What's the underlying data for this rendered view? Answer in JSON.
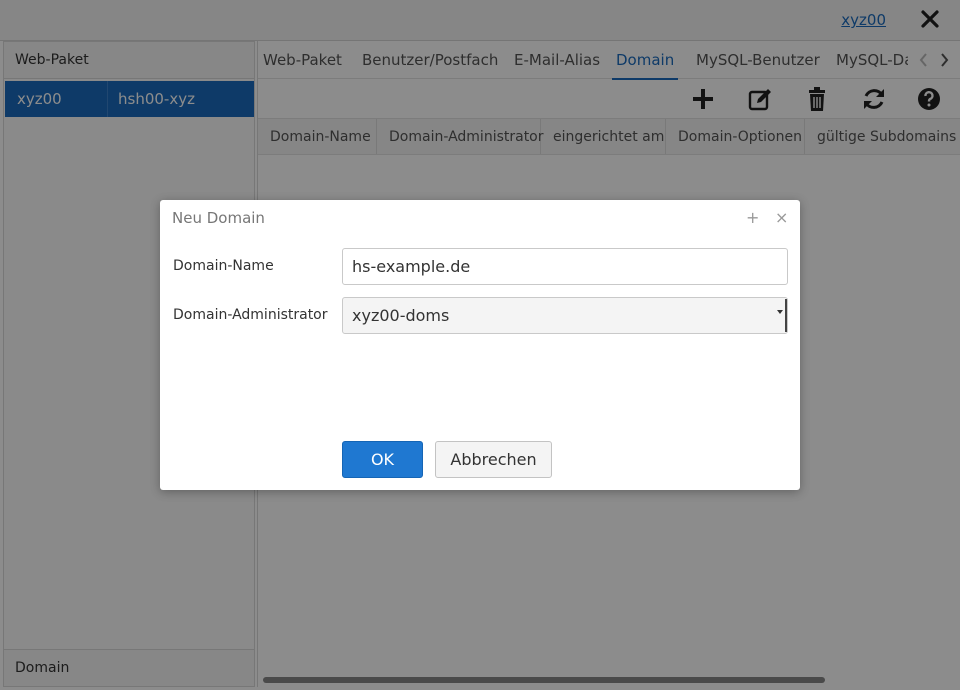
{
  "header": {
    "user_link": "xyz00"
  },
  "left_panel": {
    "header": "Web-Paket",
    "rows": [
      {
        "col1": "xyz00",
        "col2": "hsh00-xyz"
      }
    ],
    "footer": "Domain"
  },
  "tabs": [
    {
      "label": "Web-Paket"
    },
    {
      "label": "Benutzer/Postfach"
    },
    {
      "label": "E-Mail-Alias"
    },
    {
      "label": "Domain"
    },
    {
      "label": "MySQL-Benutzer"
    },
    {
      "label": "MySQL-Da"
    }
  ],
  "table": {
    "headers": [
      "Domain-Name",
      "Domain-Administrator",
      "eingerichtet am",
      "Domain-Optionen",
      "gültige Subdomains (oc"
    ]
  },
  "dialog": {
    "title": "Neu Domain",
    "domain_name_label": "Domain-Name",
    "domain_name_value": "hs-example.de",
    "domain_admin_label": "Domain-Administrator",
    "domain_admin_value": "xyz00-doms",
    "ok_label": "OK",
    "cancel_label": "Abbrechen",
    "maximize_glyph": "+",
    "close_glyph": "×"
  },
  "icons": {
    "toolbar": [
      "plus-icon",
      "edit-icon",
      "trash-icon",
      "refresh-icon",
      "help-icon"
    ],
    "tab_nav": [
      "chevron-left-icon",
      "chevron-right-icon"
    ]
  },
  "colors": {
    "accent": "#1a6bbd",
    "ok_button": "#1f78d1"
  }
}
